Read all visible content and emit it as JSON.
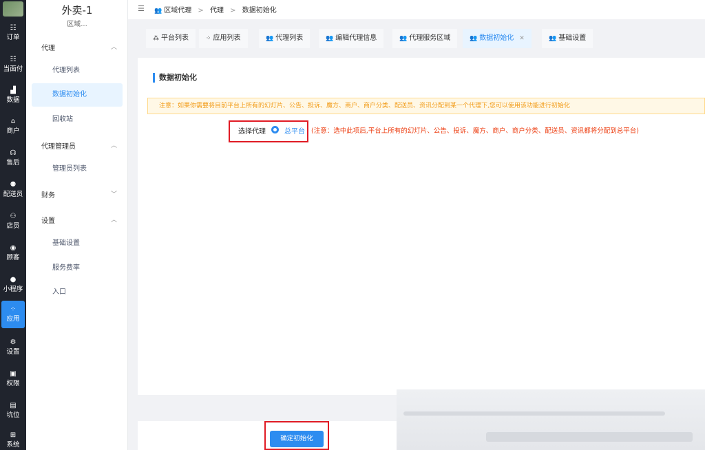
{
  "rail": {
    "items": [
      {
        "label": "订单",
        "icon": "list-icon"
      },
      {
        "label": "当面付",
        "icon": "list-icon"
      },
      {
        "label": "数据",
        "icon": "bar-chart-icon"
      },
      {
        "label": "商户",
        "icon": "store-icon"
      },
      {
        "label": "售后",
        "icon": "headset-icon"
      },
      {
        "label": "配送员",
        "icon": "scooter-icon"
      },
      {
        "label": "店员",
        "icon": "people-icon"
      },
      {
        "label": "顾客",
        "icon": "user-circle-icon"
      },
      {
        "label": "小程序",
        "icon": "wechat-icon"
      },
      {
        "label": "应用",
        "icon": "apps-icon"
      },
      {
        "label": "设置",
        "icon": "user-gear-icon"
      },
      {
        "label": "权限",
        "icon": "lock-icon"
      },
      {
        "label": "坑位",
        "icon": "document-icon"
      },
      {
        "label": "系统",
        "icon": "windows-icon"
      }
    ],
    "active_index": 9
  },
  "sidebar": {
    "brand": "外卖-1",
    "brand_sub": "区域...",
    "groups": [
      {
        "label": "代理",
        "chevron": "up"
      },
      {
        "label": "代理管理员",
        "chevron": "up"
      },
      {
        "label": "财务",
        "chevron": "down"
      },
      {
        "label": "设置",
        "chevron": "up"
      }
    ],
    "items": [
      "代理列表",
      "数据初始化",
      "回收站",
      "管理员列表",
      "基础设置",
      "服务费率",
      "入口"
    ],
    "active_item": "数据初始化"
  },
  "breadcrumb": [
    "区域代理",
    "代理",
    "数据初始化"
  ],
  "tabs": [
    {
      "label": "平台列表",
      "icon": "grid-icon"
    },
    {
      "label": "应用列表",
      "icon": "apps-icon"
    },
    {
      "label": "代理列表",
      "icon": "people-icon"
    },
    {
      "label": "编辑代理信息",
      "icon": "people-icon"
    },
    {
      "label": "代理服务区域",
      "icon": "people-icon"
    },
    {
      "label": "数据初始化",
      "icon": "people-icon",
      "active": true,
      "closable": true
    },
    {
      "label": "基础设置",
      "icon": "people-icon"
    }
  ],
  "main": {
    "title": "数据初始化",
    "notice": "注意：如果你需要将目前平台上所有的幻灯片、公告、投诉、魔方、商户、商户分类、配送员、资讯分配到某一个代理下,您可以使用该功能进行初始化",
    "field_label": "选择代理",
    "radio_option": "总平台",
    "radio_note": "(注意：选中此项后,平台上所有的幻灯片、公告、投诉、魔方、商户、商户分类、配送员、资讯都将分配到总平台)",
    "confirm_label": "确定初始化"
  },
  "colors": {
    "accent": "#2d8cf0",
    "highlight_box": "#e01b24",
    "notice_text": "#f29d1b",
    "warning_text": "#ed4014"
  }
}
